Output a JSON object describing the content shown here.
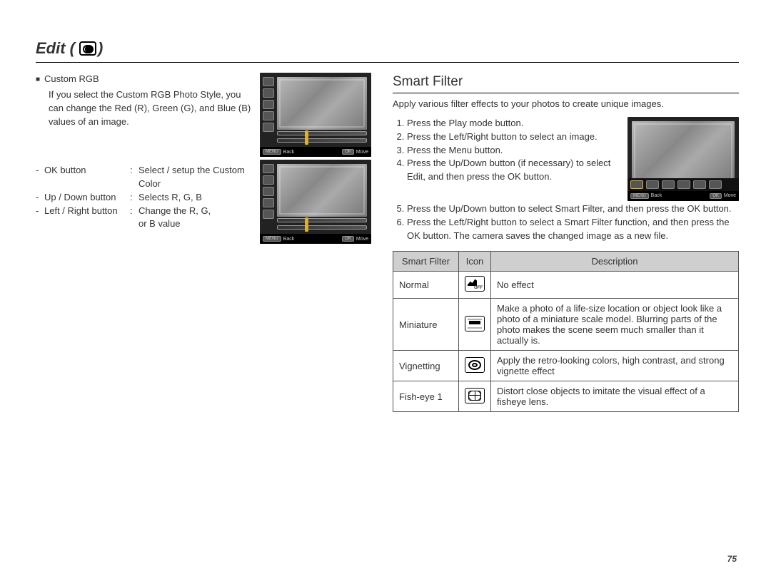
{
  "title": "Edit (",
  "title_close": ")",
  "pagenum": "75",
  "custom_rgb": {
    "heading": "Custom RGB",
    "para": "If you select the Custom RGB Photo Style, you can change the Red (R), Green (G), and Blue (B) values of an image.",
    "b1_label": "OK button",
    "b1_val": "Select / setup the Custom",
    "b1_val2": "Color",
    "b2_label": "Up / Down button",
    "b2_val": "Selects R, G, B",
    "b3_label": "Left / Right button",
    "b3_val": "Change the R, G,",
    "b3_val2": "or B value"
  },
  "camscreen_bar": {
    "back": "Back",
    "move": "Move",
    "btn": "MENU",
    "ok": "OK"
  },
  "smart_filter": {
    "heading": "Smart Filter",
    "intro": "Apply various filter effects to your photos to create unique images.",
    "steps_a": [
      "Press the Play mode button.",
      "Press the Left/Right button to select an image.",
      "Press the Menu button.",
      "Press the Up/Down button (if necessary) to select Edit, and then press the OK button."
    ],
    "steps_b": [
      "Press the Up/Down button to select Smart Filter, and then press the OK button.",
      "Press the Left/Right button to select a Smart Filter function, and then press the OK button. The camera saves the changed image as a new file."
    ],
    "strip_label": "Smart Filter",
    "table_head": {
      "c1": "Smart Filter",
      "c2": "Icon",
      "c3": "Description"
    },
    "rows": [
      {
        "name": "Normal",
        "desc": "No effect",
        "icon": "off"
      },
      {
        "name": "Miniature",
        "desc": "Make a photo of a life-size location or object look like a photo of a miniature scale model. Blurring parts of the photo makes the scene seem much smaller than it actually is.",
        "icon": "mini"
      },
      {
        "name": "Vignetting",
        "desc": "Apply the retro-looking colors, high contrast, and strong vignette effect",
        "icon": "vig"
      },
      {
        "name": "Fish-eye 1",
        "desc": "Distort close objects to imitate the visual effect of a fisheye lens.",
        "icon": "fish"
      }
    ]
  }
}
